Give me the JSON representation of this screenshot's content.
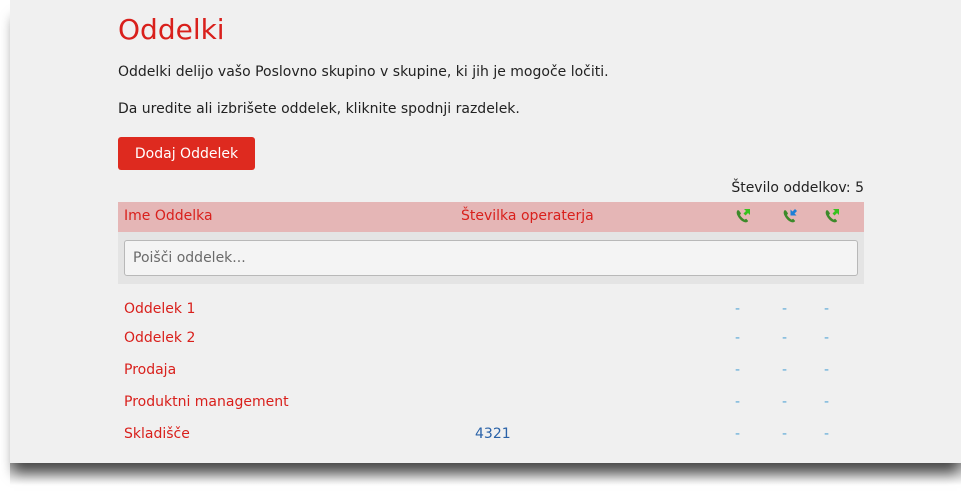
{
  "page": {
    "title": "Oddelki",
    "description_1": "Oddelki delijo vašo Poslovno skupino v skupine, ki jih je mogoče ločiti.",
    "description_2": "Da uredite ali izbrišete oddelek, kliknite spodnji razdelek.",
    "add_button_label": "Dodaj Oddelek",
    "count_label": "Število oddelkov: 5"
  },
  "table": {
    "columns": {
      "name": "Ime Oddelka",
      "operator": "Številka operaterja"
    },
    "header_icons": [
      "phone-forward-icon",
      "phone-incoming-icon",
      "phone-forward-icon"
    ],
    "search_placeholder": "Poišči oddelek...",
    "rows": [
      {
        "name": "Oddelek 1",
        "operator": "",
        "c1": "-",
        "c2": "-",
        "c3": "-"
      },
      {
        "name": "Oddelek 2",
        "operator": "",
        "c1": "-",
        "c2": "-",
        "c3": "-"
      },
      {
        "name": "Prodaja",
        "operator": "",
        "c1": "-",
        "c2": "-",
        "c3": "-"
      },
      {
        "name": "Produktni management",
        "operator": "",
        "c1": "-",
        "c2": "-",
        "c3": "-"
      },
      {
        "name": "Skladišče",
        "operator": "4321",
        "c1": "-",
        "c2": "-",
        "c3": "-"
      }
    ]
  },
  "colors": {
    "accent": "#de2a1f",
    "header_bg": "#e5b6b6",
    "phone_green": "#3d8a2a",
    "arrow_blue": "#1c7fd6",
    "arrow_green": "#38c11f",
    "dash": "#5aa7d6",
    "link_blue": "#2a62a8"
  }
}
